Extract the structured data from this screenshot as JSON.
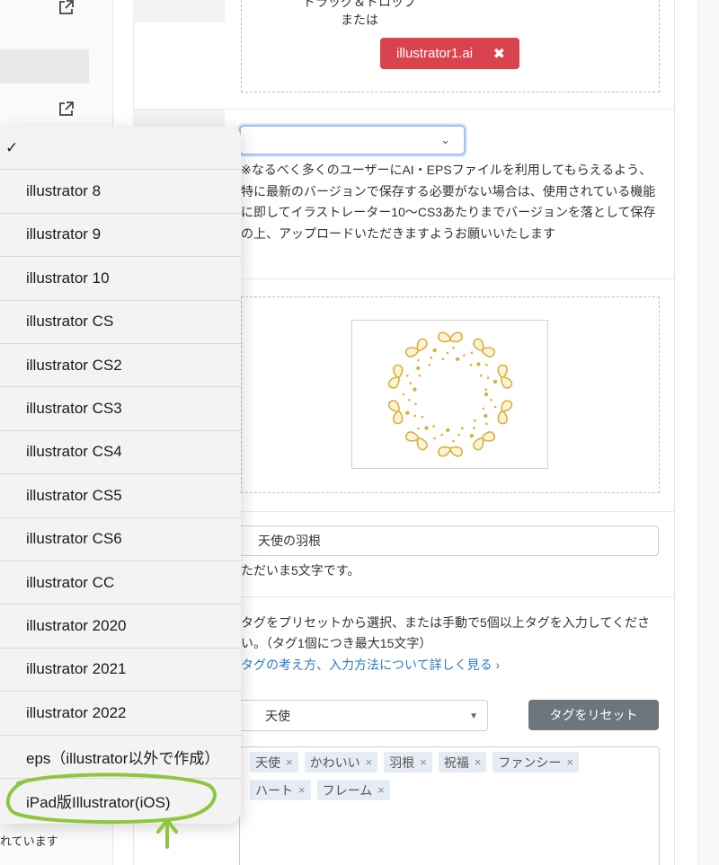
{
  "dropzone": {
    "line1": "ドラッグ＆ドロップ",
    "line2": "または",
    "file_name": "illustrator1.ai",
    "remove_icon": "✖"
  },
  "version_select": {
    "value": "",
    "chevron": "⌄"
  },
  "version_note": "※なるべく多くのユーザーにAI・EPSファイルを利用してもらえるよう、特に最新のバージョンで保存する必要がない場合は、使用されている機能に即してイラストレーター10〜CS3あたりまでバージョンを落として保存の上、アップロードいただきますようお願いいたします",
  "title": {
    "value": "天使の羽根",
    "remaining": "ただいま5文字です。"
  },
  "tags": {
    "help": "タグをプリセットから選択、または手動で5個以上タグを入力してください。（タグ1個につき最大15文字）",
    "link": "タグの考え方、入力方法について詳しく見る ›",
    "preset_value": "天使",
    "reset_label": "タグをリセット",
    "list": [
      "天使",
      "かわいい",
      "羽根",
      "祝福",
      "ファンシー",
      "ハート",
      "フレーム"
    ],
    "remove_symbol": "×"
  },
  "sidebar": {
    "footer_text": "れています"
  },
  "menu": {
    "items": [
      "✓",
      "illustrator 8",
      "illustrator 9",
      "illustrator 10",
      "illustrator CS",
      "illustrator CS2",
      "illustrator CS3",
      "illustrator CS4",
      "illustrator CS5",
      "illustrator CS6",
      "illustrator CC",
      "illustrator 2020",
      "illustrator 2021",
      "illustrator 2022",
      "eps（illustrator以外で作成）",
      "iPad版Illustrator(iOS)"
    ]
  },
  "colors": {
    "badge": "#d9434e",
    "annotation": "#8dc63f",
    "link": "#2a7ac9",
    "wreath": "#d9b13c"
  }
}
